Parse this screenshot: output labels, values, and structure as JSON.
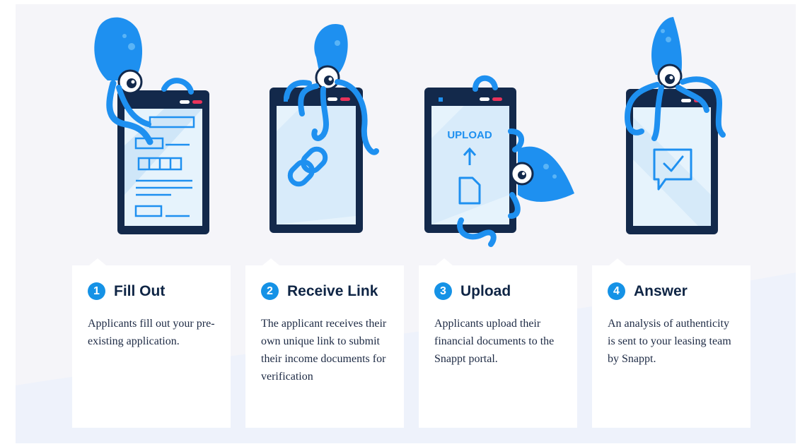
{
  "steps": [
    {
      "number": "1",
      "title": "Fill Out",
      "description": "Applicants fill out your pre-existing application.",
      "illustration": "squid-with-form-phone"
    },
    {
      "number": "2",
      "title": "Receive Link",
      "description": "The applicant receives their own unique link to submit their income documents for verification",
      "illustration": "squid-with-link-phone"
    },
    {
      "number": "3",
      "title": "Upload",
      "description": "Applicants upload their financial documents to the Snappt portal.",
      "illustration": "squid-with-upload-phone",
      "screen_label": "UPLOAD"
    },
    {
      "number": "4",
      "title": "Answer",
      "description": "An analysis of authenticity is sent to your leasing team by Snappt.",
      "illustration": "squid-with-check-phone"
    }
  ],
  "colors": {
    "background": "#f5f5f9",
    "card": "#ffffff",
    "accent": "#1592e6",
    "squid": "#1e90f0",
    "phone_frame": "#13294b",
    "screen": "#e6f3fc",
    "title": "#0f2545",
    "body_text": "#1d2a44"
  }
}
